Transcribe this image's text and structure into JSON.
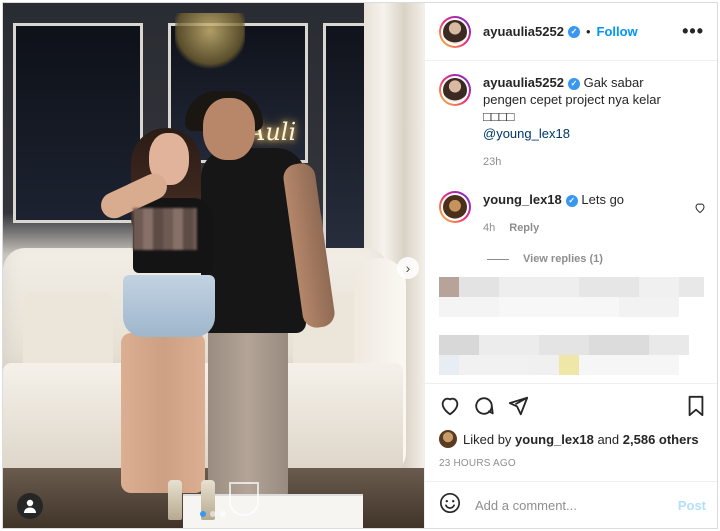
{
  "header": {
    "username": "ayuaulia5252",
    "separator": "•",
    "follow_label": "Follow",
    "more_label": "•••"
  },
  "caption": {
    "username": "ayuaulia5252",
    "text": "Gak sabar pengen cepet project nya kelar □□□□",
    "mention": "@young_lex18",
    "time": "23h"
  },
  "comment": {
    "username": "young_lex18",
    "text": "Lets go",
    "time": "4h",
    "reply_label": "Reply",
    "view_replies": "View replies (1)"
  },
  "photo": {
    "neon_text": "Auli",
    "nav_arrow": "›",
    "dots_count": 3
  },
  "likes": {
    "prefix": "Liked by",
    "user": "young_lex18",
    "middle": "and",
    "others": "2,586 others"
  },
  "timestamp": "23 HOURS AGO",
  "add_comment": {
    "placeholder": "Add a comment...",
    "post_label": "Post"
  },
  "colors": {
    "accent": "#0095f6",
    "verified": "#3897f0",
    "muted": "#8e8e8e",
    "post_disabled": "#b2dffc"
  },
  "icons": [
    "more-icon",
    "verified-icon",
    "heart-icon",
    "comment-icon",
    "share-icon",
    "save-icon",
    "emoji-icon",
    "user-tag-icon",
    "next-arrow-icon"
  ]
}
